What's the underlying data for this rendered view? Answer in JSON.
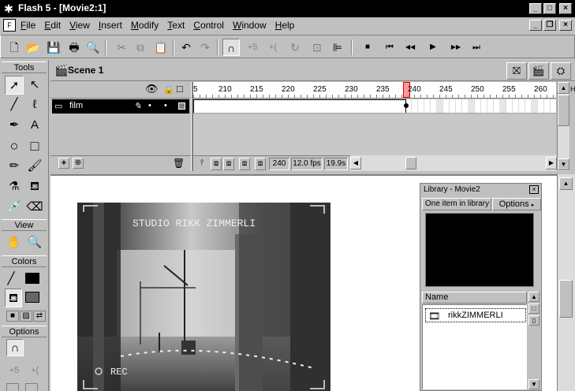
{
  "window": {
    "title": "Flash 5 - [Movie2:1]",
    "min": "_",
    "max": "□",
    "close": "×",
    "doc_min": "_",
    "doc_restore": "❐",
    "doc_close": "×"
  },
  "menu": {
    "items": [
      "File",
      "Edit",
      "View",
      "Insert",
      "Modify",
      "Text",
      "Control",
      "Window",
      "Help"
    ]
  },
  "icons": {
    "new": "🗋",
    "open": "📂",
    "save": "💾",
    "print": "🖶",
    "print_preview": "🔍",
    "cut": "✂",
    "copy": "⧉",
    "paste": "📋",
    "undo": "↶",
    "redo": "↷",
    "snap": "∩",
    "smooth": "+5",
    "straighten": "+(",
    "rotate": "↻",
    "scale": "⊡",
    "align": "⊫",
    "stop": "■",
    "rewind": "⏮",
    "step_back": "◀◀",
    "play": "▶",
    "step_fwd": "▶▶",
    "to_end": "⏭"
  },
  "tools": {
    "label": "Tools",
    "view_label": "View",
    "colors_label": "Colors",
    "options_label": "Options",
    "arrow": "➚",
    "subselect": "↖",
    "line": "╱",
    "lasso": "ℓ",
    "pen": "✒",
    "text": "A",
    "oval": "○",
    "rect": "□",
    "pencil": "✏",
    "brush": "🖌",
    "ink": "⚗",
    "bucket": "⛾",
    "dropper": "💉",
    "eraser": "⌫",
    "hand": "✋",
    "zoom": "🔍",
    "stroke_icon": "╱",
    "fill_icon": "⛾",
    "stroke_color": "#000000",
    "fill_color": "#666666",
    "swap_default": "■",
    "no_color": "▨",
    "swap": "⇄",
    "opt_snap": "∩",
    "opt_smooth": "+5",
    "opt_straighten": "+("
  },
  "timeline": {
    "scene_name": "Scene 1",
    "edit_scene": "🎬",
    "edit_symbol": "⛝",
    "zoom_ctrl": "⛭",
    "eye": "👁",
    "lock": "🔒",
    "outline": "□",
    "layer_name": "film",
    "layer_icon": "▭",
    "pencil": "✎",
    "dot1": "•",
    "dot2": "•",
    "add_layer": "+",
    "add_guide": "⊕",
    "delete_layer": "🗑",
    "ruler_labels": [
      "5",
      "210",
      "215",
      "220",
      "225",
      "230",
      "235",
      "240",
      "245",
      "250",
      "255",
      "260"
    ],
    "frame_num": "240",
    "fps": "12.0 fps",
    "time": "19.9s",
    "status_icons": [
      "⫯",
      "⧈",
      "⧈",
      "⧈",
      "⧈"
    ],
    "scroll_left": "◀",
    "scroll_right": "▶",
    "scroll_up": "▲",
    "scroll_down": "▼",
    "h_label": "H"
  },
  "stage": {
    "overlay_title": "STUDIO RIKK ZIMMERLI",
    "overlay_rec": "REC",
    "scroll_up": "▲",
    "scroll_down": "▼"
  },
  "library": {
    "title": "Library - Movie2",
    "close": "×",
    "count": "One item in library",
    "options": "Options",
    "options_arrow": "▸",
    "name_header": "Name",
    "item_name": "rikkZIMMERLI",
    "item_icon": "🎞",
    "sort": "▲",
    "side_btns": [
      "□",
      "▯",
      "▼"
    ]
  }
}
